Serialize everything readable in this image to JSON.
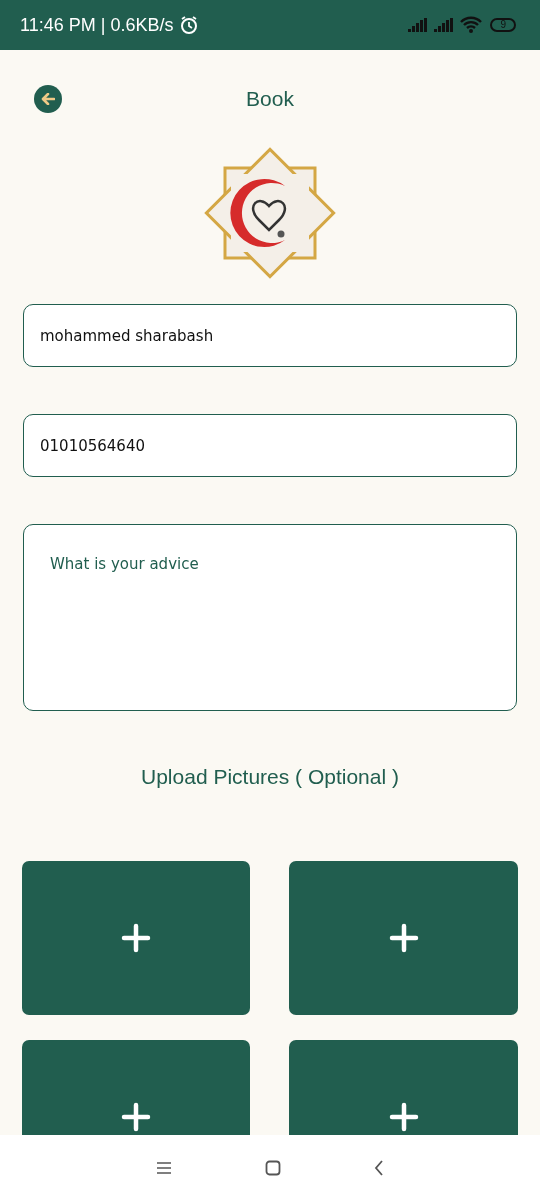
{
  "status_bar": {
    "time": "11:46 PM | 0.6KB/s",
    "battery": "9"
  },
  "header": {
    "title": "Book"
  },
  "form": {
    "name": {
      "value": "mohammed sharabash"
    },
    "phone": {
      "value": "01010564640"
    },
    "advice": {
      "placeholder": "What is your advice"
    }
  },
  "upload": {
    "title": "Upload Pictures ( Optional )",
    "slots": [
      {
        "kind": "empty"
      },
      {
        "kind": "empty"
      },
      {
        "kind": "empty"
      },
      {
        "kind": "empty"
      }
    ]
  }
}
